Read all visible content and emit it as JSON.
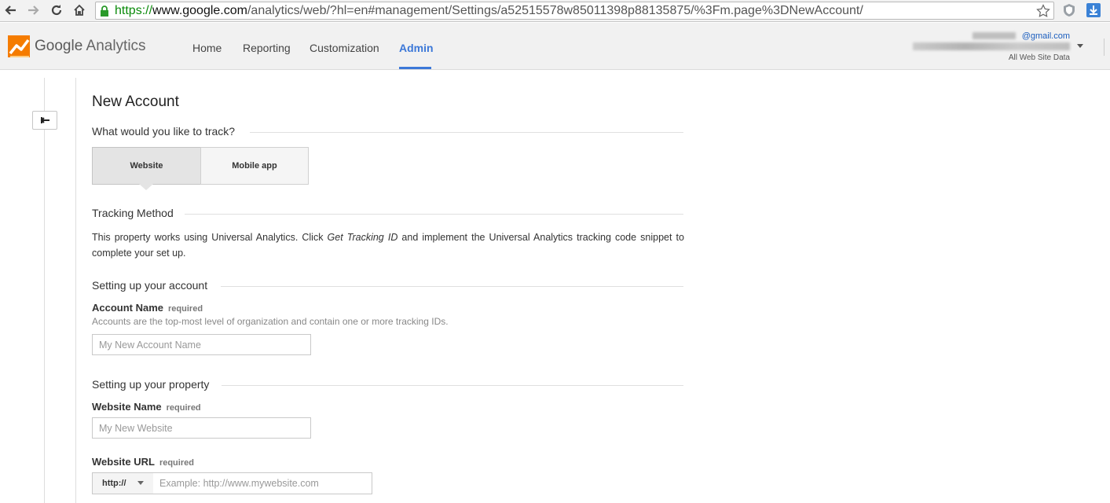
{
  "browser": {
    "url_scheme": "https://",
    "url_host": "www.google.com",
    "url_path": "/analytics/web/?hl=en#management/Settings/a52515578w85011398p88135875/%3Fm.page%3DNewAccount/"
  },
  "header": {
    "brand_google": "Google",
    "brand_product": "Analytics",
    "nav": [
      "Home",
      "Reporting",
      "Customization",
      "Admin"
    ],
    "active_nav": "Admin",
    "account_email_suffix": "@gmail.com",
    "account_sub": "All Web Site Data"
  },
  "form": {
    "title": "New Account",
    "track_question": "What would you like to track?",
    "track_options": [
      "Website",
      "Mobile app"
    ],
    "selected_option": "Website",
    "tracking_method_head": "Tracking Method",
    "tracking_text_1": "This property works using Universal Analytics. Click ",
    "tracking_text_em": "Get Tracking ID",
    "tracking_text_2": " and implement the Universal Analytics tracking code snippet to complete your set up.",
    "account_section": "Setting up your account",
    "account_name_label": "Account Name",
    "required_label": "required",
    "account_help": "Accounts are the top-most level of organization and contain one or more tracking IDs.",
    "account_placeholder": "My New Account Name",
    "property_section": "Setting up your property",
    "website_name_label": "Website Name",
    "website_name_placeholder": "My New Website",
    "website_url_label": "Website URL",
    "protocol": "http://",
    "website_url_placeholder": "Example: http://www.mywebsite.com"
  },
  "colors": {
    "accent": "#3c78d8",
    "secure_green": "#0a8a0a"
  }
}
